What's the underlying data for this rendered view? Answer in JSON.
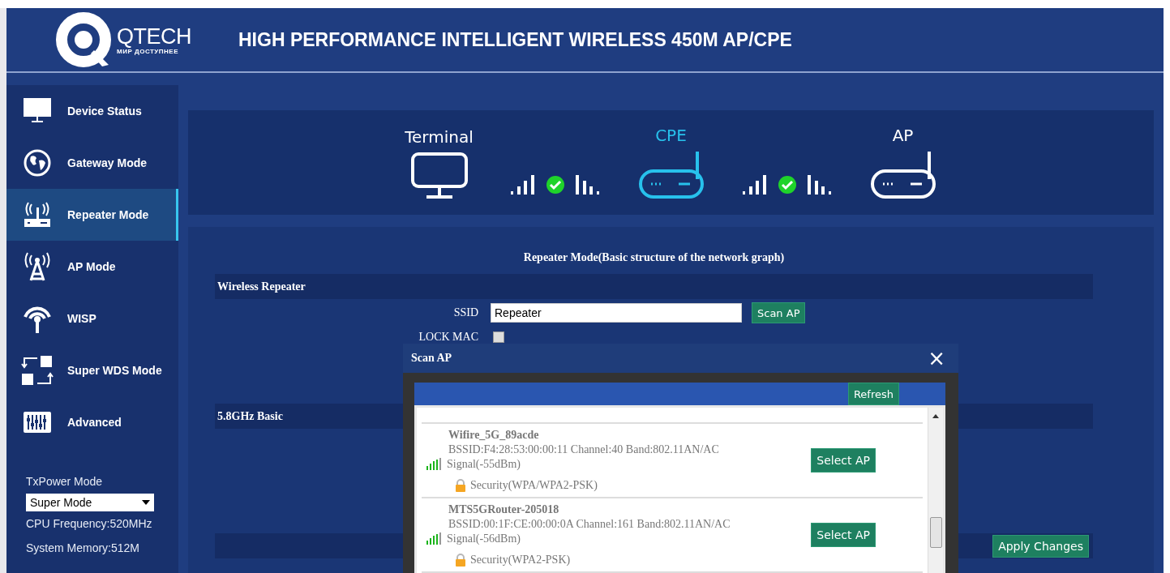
{
  "header": {
    "logo_name": "QTECH",
    "logo_tagline": "МИР ДОСТУПНЕЕ",
    "title": "HIGH PERFORMANCE INTELLIGENT WIRELESS 450M AP/CPE"
  },
  "sidebar": {
    "items": [
      {
        "label": "Device Status",
        "kind": "monitor",
        "selected": false
      },
      {
        "label": "Gateway Mode",
        "kind": "globe",
        "selected": false
      },
      {
        "label": "Repeater Mode",
        "kind": "repeater",
        "selected": true
      },
      {
        "label": "AP Mode",
        "kind": "tower",
        "selected": false
      },
      {
        "label": "WISP",
        "kind": "wisp",
        "selected": false
      },
      {
        "label": "Super WDS Mode",
        "kind": "wds",
        "selected": false
      },
      {
        "label": "Advanced",
        "kind": "equalizer",
        "selected": false
      }
    ],
    "txpower_label": "TxPower Mode",
    "txpower_value": "Super Mode",
    "info": [
      "CPU Frequency:520MHz",
      "System Memory:512M"
    ]
  },
  "topology": {
    "nodes": [
      {
        "label": "Terminal",
        "kind": "terminal",
        "selected": false
      },
      {
        "label": "CPE",
        "kind": "router",
        "selected": true
      },
      {
        "label": "AP",
        "kind": "router",
        "selected": false
      }
    ],
    "links": [
      {
        "connected": true
      },
      {
        "connected": true
      }
    ]
  },
  "form": {
    "title": "Repeater Mode(Basic structure of the network graph)",
    "wireless_section": "Wireless Repeater",
    "ssid_label": "SSID",
    "ssid_value": "Repeater",
    "scan_button": "Scan AP",
    "lock_mac_label": "LOCK MAC",
    "lock_mac_checked": false,
    "basic_section": "5.8GHz Basic",
    "apply_button": "Apply Changes"
  },
  "dialog": {
    "title": "Scan AP",
    "close": "×",
    "refresh_button": "Refresh",
    "entries": [
      {
        "ssid": "Wifire_5G_89acde",
        "details": "BSSID:F4:28:53:00:00:11 Channel:40 Band:802.11AN/AC",
        "signal": "Signal(-55dBm)",
        "security": "Security(WPA/WPA2-PSK)",
        "button": "Select AP"
      },
      {
        "ssid": "MTS5GRouter-205018",
        "details": "BSSID:00:1F:CE:00:00:0A Channel:161 Band:802.11AN/AC",
        "signal": "Signal(-56dBm)",
        "security": "Security(WPA2-PSK)",
        "button": "Select AP"
      }
    ]
  }
}
